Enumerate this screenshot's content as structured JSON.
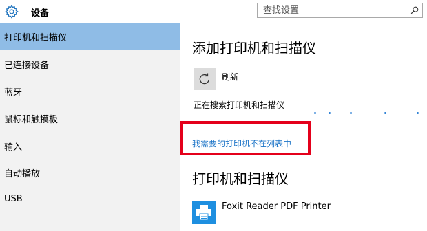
{
  "header": {
    "title": "设备",
    "search_placeholder": "查找设置"
  },
  "sidebar": {
    "items": [
      {
        "label": "打印机和扫描仪"
      },
      {
        "label": "已连接设备"
      },
      {
        "label": "蓝牙"
      },
      {
        "label": "鼠标和触摸板"
      },
      {
        "label": "输入"
      },
      {
        "label": "自动播放"
      },
      {
        "label": "USB"
      }
    ]
  },
  "main": {
    "add_heading": "添加打印机和扫描仪",
    "refresh_label": "刷新",
    "searching_text": "正在搜索打印机和扫描仪",
    "printer_not_listed_link": "我需要的打印机不在列表中",
    "printers_heading": "打印机和扫描仪",
    "printers": [
      {
        "name": "Foxit Reader PDF Printer"
      }
    ]
  },
  "colors": {
    "accent": "#1e8fe0",
    "selected_nav": "#8fbce6",
    "highlight_border": "#e4001b",
    "link": "#1a73c7"
  },
  "icons": [
    "gear-icon",
    "search-icon",
    "refresh-icon",
    "printer-icon"
  ]
}
